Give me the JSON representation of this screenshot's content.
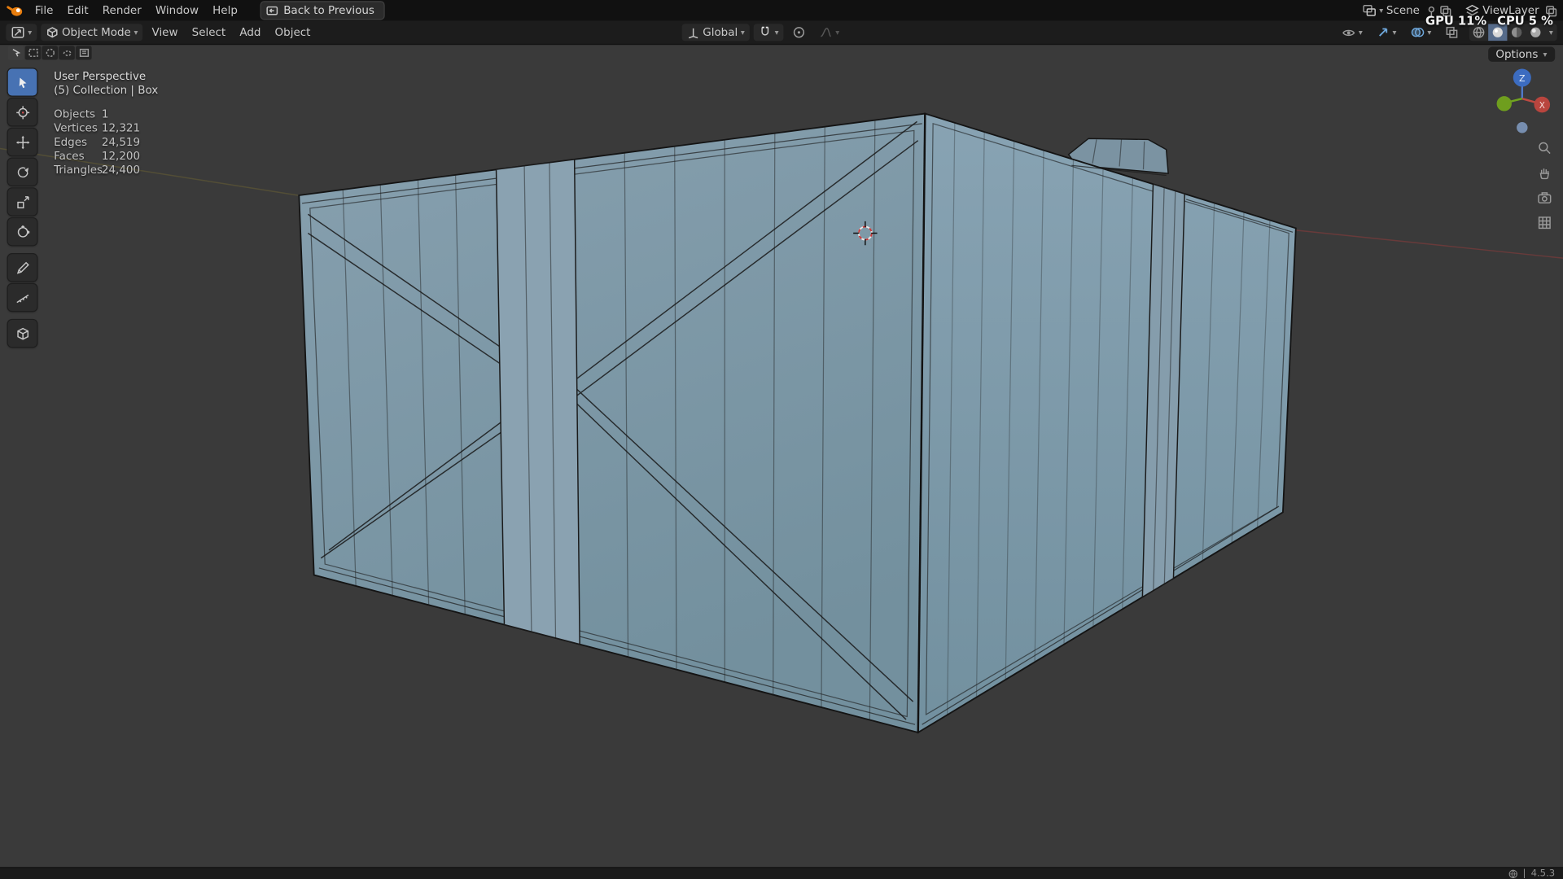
{
  "icons": {
    "chevron_down": "▾",
    "divider": "|"
  },
  "topbar": {
    "menus": [
      "File",
      "Edit",
      "Render",
      "Window",
      "Help"
    ],
    "back_button_label": "Back to Previous",
    "scene_label": "Scene",
    "viewlayer_label": "ViewLayer",
    "gpu_stat": "GPU 11%",
    "cpu_stat": "CPU 5 %"
  },
  "viewport_header": {
    "mode_label": "Object Mode",
    "menus": [
      "View",
      "Select",
      "Add",
      "Object"
    ],
    "orientation_label": "Global",
    "options_label": "Options"
  },
  "viewport_overlay": {
    "perspective_label": "User Perspective",
    "breadcrumb": "(5) Collection | Box",
    "stats": [
      {
        "label": "Objects",
        "value": "1"
      },
      {
        "label": "Vertices",
        "value": "12,321"
      },
      {
        "label": "Edges",
        "value": "24,519"
      },
      {
        "label": "Faces",
        "value": "12,200"
      },
      {
        "label": "Triangles",
        "value": "24,400"
      }
    ]
  },
  "nav_gizmo": {
    "z_label": "Z",
    "x_label": "X"
  },
  "statusbar": {
    "version": "4.5.3"
  },
  "colors": {
    "accent": "#4772b3",
    "viewport_bg": "#3a3a3a",
    "crate_left_face": "#7d95a4",
    "crate_right_face": "#7a93a3",
    "wire": "#1b1b1b"
  }
}
